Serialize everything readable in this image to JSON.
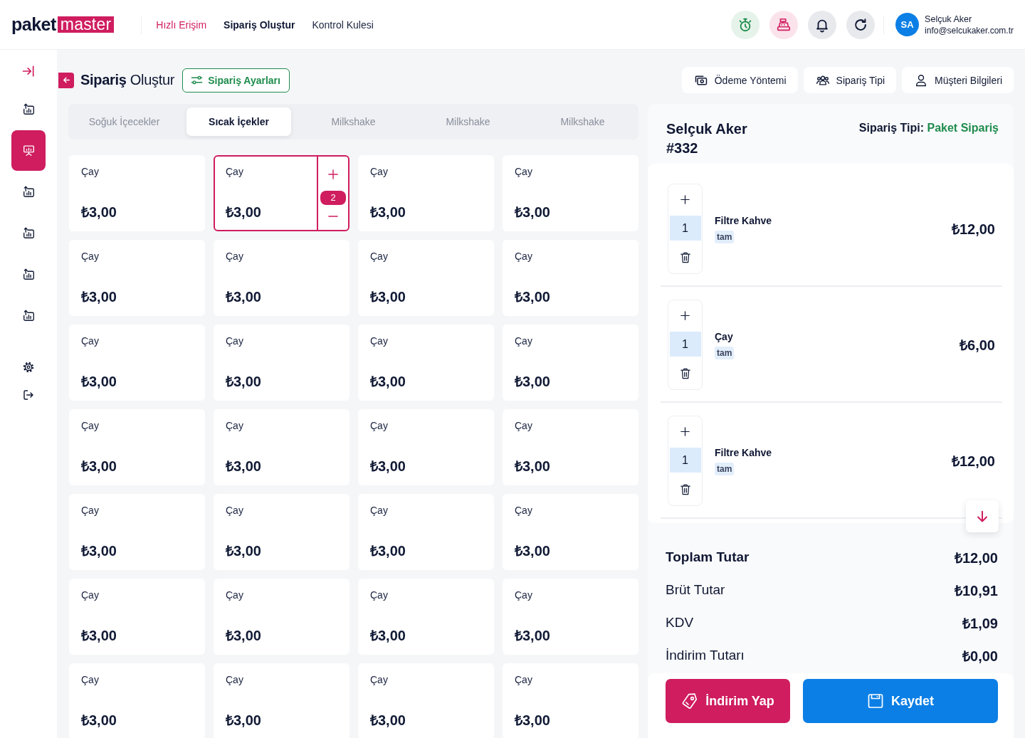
{
  "topbar": {
    "logo": {
      "word": "paket",
      "highlight": "master"
    },
    "nav": [
      {
        "label": "Hızlı Erişim",
        "kind": "accent",
        "selected": false
      },
      {
        "label": "Sipariş Oluştur",
        "kind": "plain",
        "selected": true
      },
      {
        "label": "Kontrol Kulesi",
        "kind": "plain",
        "selected": false
      }
    ]
  },
  "user": {
    "initials": "SA",
    "name": "Selçuk Aker",
    "email": "info@selcukaker.com.tr"
  },
  "sidebar": {
    "items": [
      {
        "kind": "chart",
        "selected": false
      },
      {
        "kind": "board",
        "selected": true
      },
      {
        "kind": "chart",
        "selected": false
      },
      {
        "kind": "chart",
        "selected": false
      },
      {
        "kind": "chart",
        "selected": false
      },
      {
        "kind": "chart",
        "selected": false
      }
    ]
  },
  "page_header": {
    "title": "**Sipariş** Oluştur",
    "settings_button": "Sipariş Ayarları",
    "buttons": [
      {
        "label": "Ödeme Yöntemi",
        "kind": "payment"
      },
      {
        "label": "Sipariş Tipi",
        "kind": "type"
      },
      {
        "label": "Müşteri Bilgileri",
        "kind": "customer"
      }
    ]
  },
  "categories": [
    {
      "label": "Soğuk İçecekler",
      "selected": false
    },
    {
      "label": "Sıcak İçekler",
      "selected": true
    },
    {
      "label": "Milkshake",
      "selected": false
    },
    {
      "label": "Milkshake",
      "selected": false
    },
    {
      "label": "Milkshake",
      "selected": false
    }
  ],
  "products": [
    {
      "name": "Çay",
      "price": "₺3,00",
      "selected": false
    },
    {
      "name": "Çay",
      "price": "₺3,00",
      "selected": true,
      "quantity": "2"
    },
    {
      "name": "Çay",
      "price": "₺3,00",
      "selected": false
    },
    {
      "name": "Çay",
      "price": "₺3,00",
      "selected": false
    },
    {
      "name": "Çay",
      "price": "₺3,00",
      "selected": false
    },
    {
      "name": "Çay",
      "price": "₺3,00",
      "selected": false
    },
    {
      "name": "Çay",
      "price": "₺3,00",
      "selected": false
    },
    {
      "name": "Çay",
      "price": "₺3,00",
      "selected": false
    },
    {
      "name": "Çay",
      "price": "₺3,00",
      "selected": false
    },
    {
      "name": "Çay",
      "price": "₺3,00",
      "selected": false
    },
    {
      "name": "Çay",
      "price": "₺3,00",
      "selected": false
    },
    {
      "name": "Çay",
      "price": "₺3,00",
      "selected": false
    },
    {
      "name": "Çay",
      "price": "₺3,00",
      "selected": false
    },
    {
      "name": "Çay",
      "price": "₺3,00",
      "selected": false
    },
    {
      "name": "Çay",
      "price": "₺3,00",
      "selected": false
    },
    {
      "name": "Çay",
      "price": "₺3,00",
      "selected": false
    },
    {
      "name": "Çay",
      "price": "₺3,00",
      "selected": false
    },
    {
      "name": "Çay",
      "price": "₺3,00",
      "selected": false
    },
    {
      "name": "Çay",
      "price": "₺3,00",
      "selected": false
    },
    {
      "name": "Çay",
      "price": "₺3,00",
      "selected": false
    },
    {
      "name": "Çay",
      "price": "₺3,00",
      "selected": false
    },
    {
      "name": "Çay",
      "price": "₺3,00",
      "selected": false
    },
    {
      "name": "Çay",
      "price": "₺3,00",
      "selected": false
    },
    {
      "name": "Çay",
      "price": "₺3,00",
      "selected": false
    },
    {
      "name": "Çay",
      "price": "₺3,00",
      "selected": false
    },
    {
      "name": "Çay",
      "price": "₺3,00",
      "selected": false
    },
    {
      "name": "Çay",
      "price": "₺3,00",
      "selected": false
    },
    {
      "name": "Çay",
      "price": "₺3,00",
      "selected": false
    }
  ],
  "order": {
    "customer": "Selçuk Aker",
    "number": "#332",
    "type_label": "Sipariş Tipi:",
    "type_value": "Paket Sipariş",
    "items": [
      {
        "name": "Filtre Kahve",
        "tag": "tam",
        "quantity": "1",
        "price": "₺12,00"
      },
      {
        "name": "Çay",
        "tag": "tam",
        "quantity": "1",
        "price": "₺6,00"
      },
      {
        "name": "Filtre Kahve",
        "tag": "tam",
        "quantity": "1",
        "price": "₺12,00"
      }
    ],
    "totals": [
      {
        "label": "Toplam Tutar",
        "value": "₺12,00",
        "kind": "total"
      },
      {
        "label": "Brüt Tutar",
        "value": "₺10,91",
        "kind": "line"
      },
      {
        "label": "KDV",
        "value": "₺1,09",
        "kind": "line"
      },
      {
        "label": "İndirim Tutarı",
        "value": "₺0,00",
        "kind": "line"
      }
    ],
    "discount_button": "İndirim Yap",
    "save_button": "Kaydet"
  }
}
